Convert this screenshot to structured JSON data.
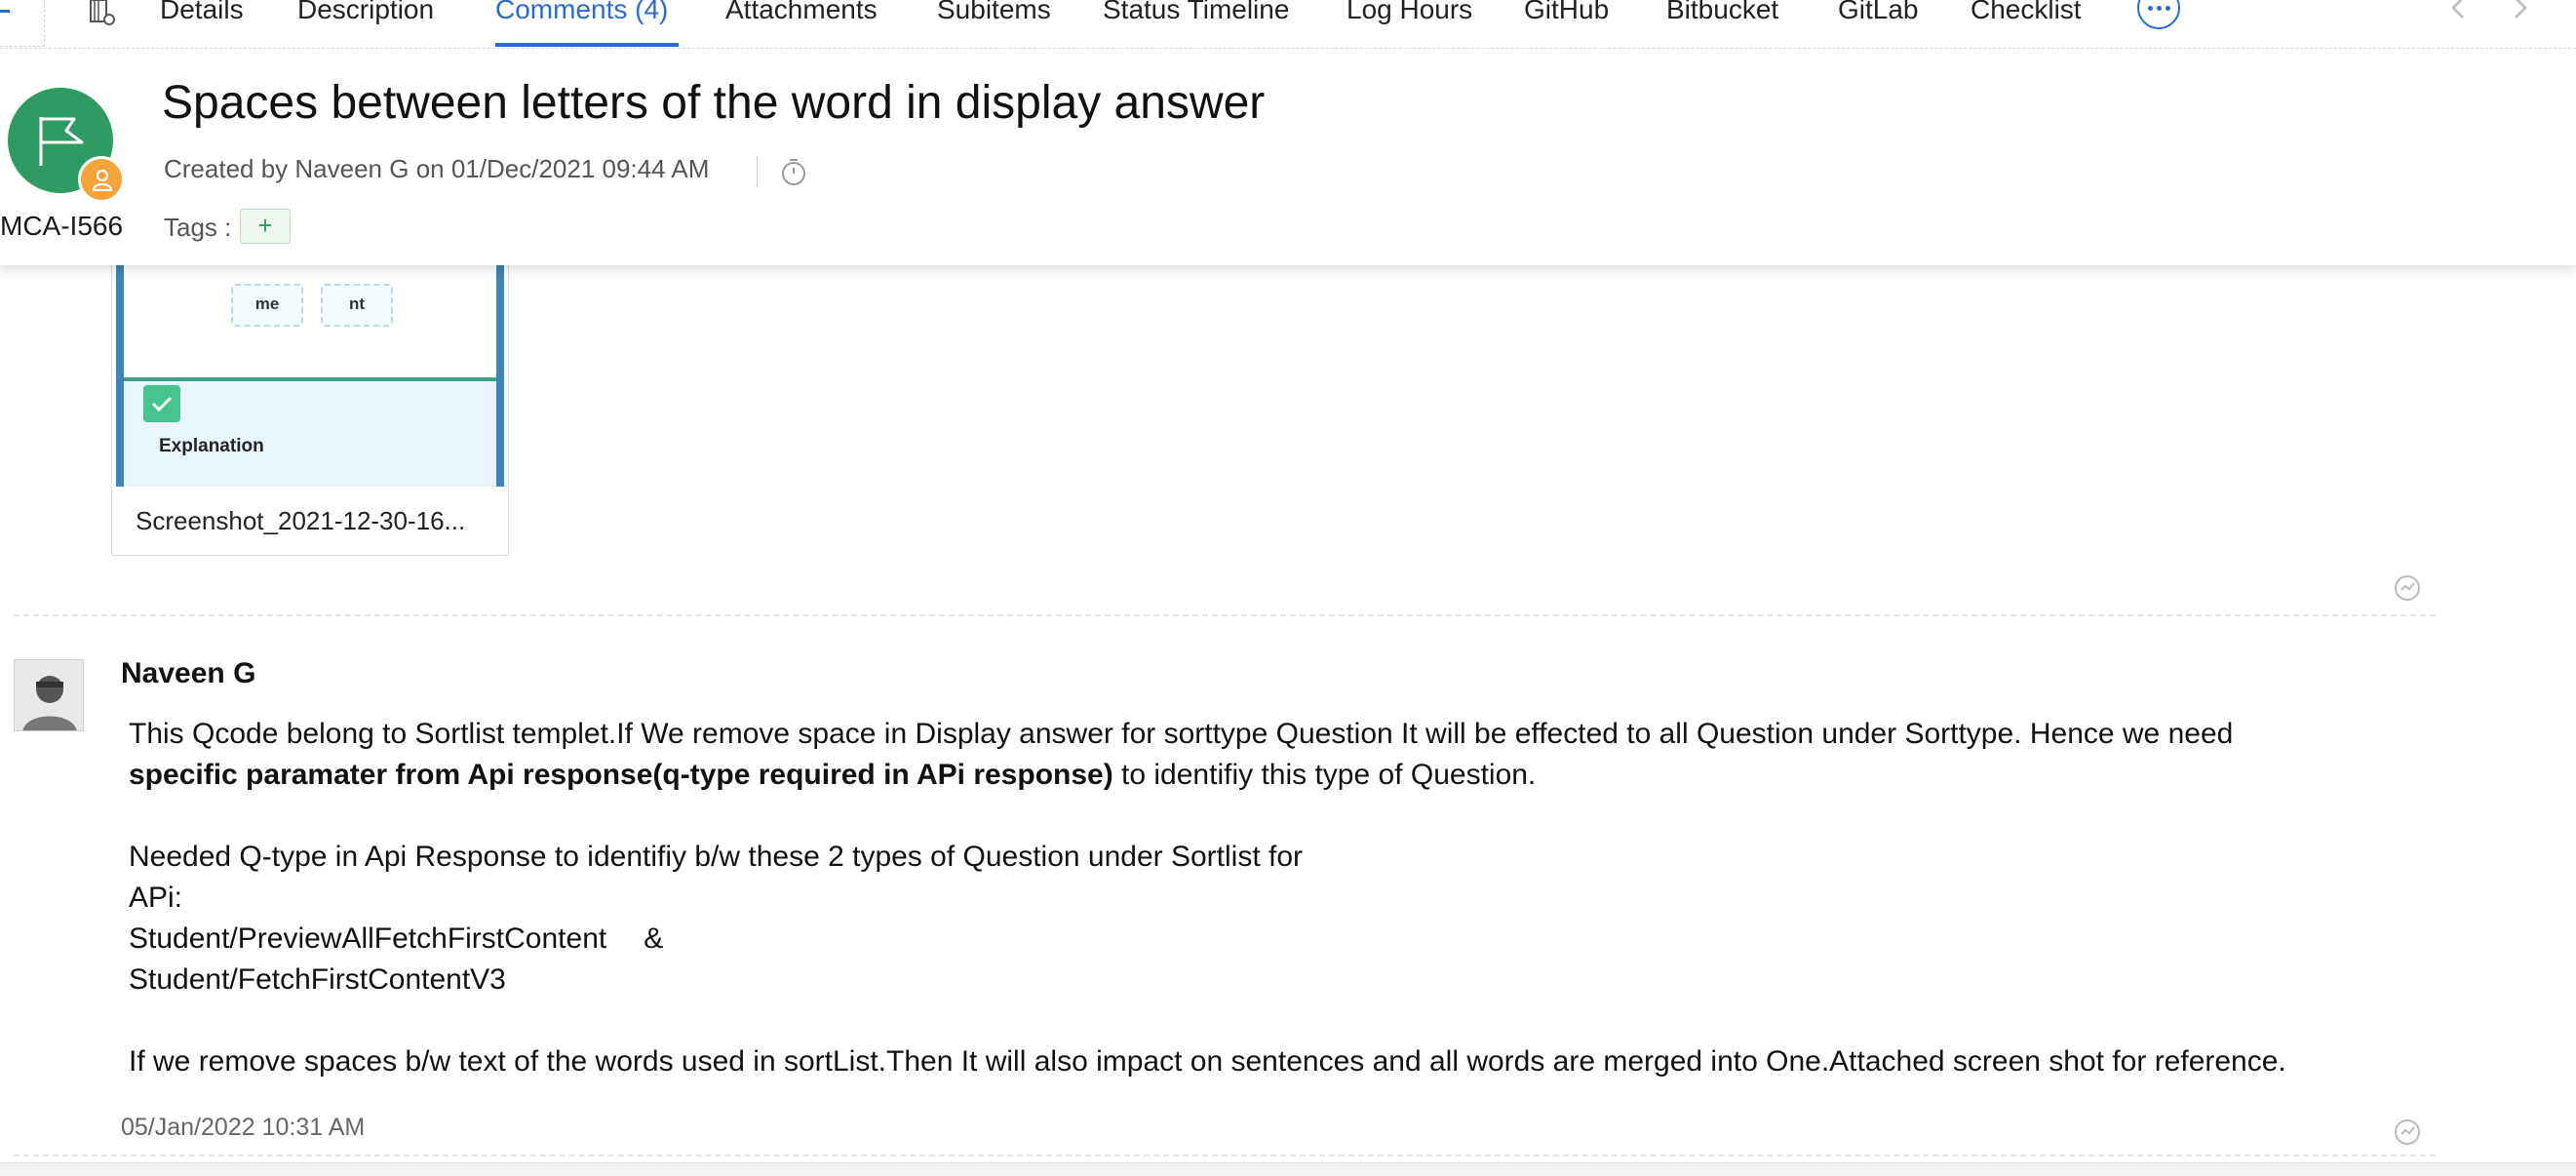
{
  "tabs": [
    {
      "id": "details",
      "label": "Details"
    },
    {
      "id": "description",
      "label": "Description"
    },
    {
      "id": "comments",
      "label": "Comments (4)",
      "active": true
    },
    {
      "id": "attachments",
      "label": "Attachments"
    },
    {
      "id": "subitems",
      "label": "Subitems"
    },
    {
      "id": "status-timeline",
      "label": "Status Timeline"
    },
    {
      "id": "log-hours",
      "label": "Log Hours"
    },
    {
      "id": "github",
      "label": "GitHub"
    },
    {
      "id": "bitbucket",
      "label": "Bitbucket"
    },
    {
      "id": "gitlab",
      "label": "GitLab"
    },
    {
      "id": "checklist",
      "label": "Checklist"
    }
  ],
  "issue": {
    "id": "MCA-I566",
    "title": "Spaces between letters of the word in display answer",
    "created_meta": "Created by Naveen G on 01/Dec/2021 09:44 AM",
    "tags_label": "Tags :",
    "tag_add_label": "+"
  },
  "attachment": {
    "filename": "Screenshot_2021-12-30-16...",
    "preview": {
      "chip1": "me",
      "chip2": "nt",
      "heading": "Explanation"
    }
  },
  "comment": {
    "author": "Naveen G",
    "para1_pre": "This Qcode belong to Sortlist templet.If We remove space in Display answer for sorttype Question It will be effected to all Question under Sorttype. Hence we need",
    "para1_bold": "specific paramater from Api response(q-type required in APi response)",
    "para1_post": " to identifiy this type of Question.",
    "line_needed": "Needed Q-type in Api Response to identifiy b/w these 2 types of Question under Sortlist for",
    "line_api": "APi:",
    "line_api1": "Student/PreviewAllFetchFirstContent",
    "amp": "&",
    "line_api2": "Student/FetchFirstContentV3",
    "para_last": "If we remove spaces b/w text of the words used in sortList.Then It will also impact on sentences and all words are merged into One.Attached screen shot for reference.",
    "timestamp": "05/Jan/2022 10:31 AM"
  },
  "colors": {
    "accent": "#2a6ad4",
    "status_green": "#2f9a61",
    "owner_orange": "#f4a43a"
  }
}
